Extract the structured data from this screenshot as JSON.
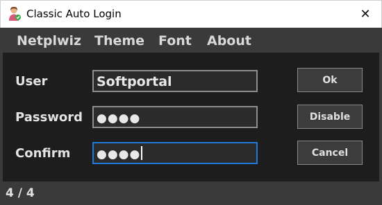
{
  "window": {
    "title": "Classic Auto Login",
    "close_glyph": "✕"
  },
  "menu": [
    "Netplwiz",
    "Theme",
    "Font",
    "About"
  ],
  "form": {
    "user_label": "User",
    "user_value": "Softportal",
    "password_label": "Password",
    "password_value": "●●●●",
    "confirm_label": "Confirm",
    "confirm_value": "●●●●"
  },
  "buttons": {
    "ok": "Ok",
    "disable": "Disable",
    "cancel": "Cancel"
  },
  "status": {
    "text": "4 / 4"
  },
  "colors": {
    "window_bg": "#3a3a3a",
    "panel_bg": "#1d1d1d",
    "focus_border": "#1e7ad6"
  }
}
